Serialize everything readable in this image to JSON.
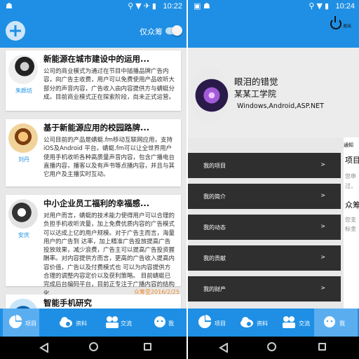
{
  "left": {
    "status_time": "10:22",
    "filter_label": "仅众筹",
    "cards": [
      {
        "author": "朱颜坊",
        "title": "新能源在城市建设中的运用...",
        "body": "公司的商业模式为通过在节目中插播品牌广告内容，向广告主收费，用户可以免费使用产品收听大部分的声音内容，广告收入由内容提供方与蜻蜓分成。目前商业模式正在探索阶段，尚未正式运营。"
      },
      {
        "author": "刘丹",
        "title": "基于新能源应用的校园路牌...",
        "body": "公司目前的产品是蜻蜓.fm移动互联网应用，支持iOS及Android 平台。蜻蜓.fm可以让全世界用户使用手机收听各种高质量声音内容，包含广播电台直播内容，播客以及有声书等点播内容，并且与其它用户及主播实时互动。"
      },
      {
        "author": "安庆",
        "title": "中小企业员工福利的幸福感...",
        "body": "对用户而言，蜻蜓的技术能力使得用户可以合理的负担手机收听流量，加上免费优质内容的广告模式可以达成上亿的用户规模。对于广告主而言，海量用户的广告到 达率，加上精准广告投放提高广告投放效果，减少浪费，广告主可以提高广告投资握酬率。对内容提供方而言，更高的广告收入提高内容价值，广告以及付费模式也 可以为内容提供方合理的调整内容定价以及获利策略。 目前蜻蜓已完成后台编码平台，目前正专注于广播内容的结构化",
        "date": "众筹至2016/2/25"
      },
      {
        "author": "",
        "title": "智能手机研究",
        "body": ""
      }
    ],
    "tabs": [
      {
        "label": "项目",
        "icon": "project-icon"
      },
      {
        "label": "资料",
        "icon": "cloud-search-icon"
      },
      {
        "label": "交流",
        "icon": "people-icon"
      },
      {
        "label": "我",
        "icon": "face-icon"
      }
    ]
  },
  "right": {
    "status_time": "10:24",
    "logout_label": "退出",
    "profile": {
      "name": "眼泪的错觉",
      "school": "某某工学院",
      "skills": "Windows,Android,ASP.NET"
    },
    "menu": [
      {
        "label": "我的项目"
      },
      {
        "label": "我的简介"
      },
      {
        "label": "我的动态"
      },
      {
        "label": "我的贡献"
      },
      {
        "label": "我的财产"
      }
    ],
    "menu_arrow": ">",
    "side_peek": {
      "notice": "通知",
      "line1": "项目",
      "line2": "您申",
      "line3": "过，",
      "line4": "众筹",
      "line5": "您支",
      "line6": "标金"
    },
    "tabs": [
      {
        "label": "项目",
        "icon": "project-icon"
      },
      {
        "label": "资料",
        "icon": "cloud-search-icon"
      },
      {
        "label": "交流",
        "icon": "people-icon"
      },
      {
        "label": "我",
        "icon": "face-icon"
      }
    ]
  },
  "colors": {
    "accent": "#1e8fe4",
    "menu_bg": "#2f2f2f",
    "date": "#f08a2a"
  }
}
